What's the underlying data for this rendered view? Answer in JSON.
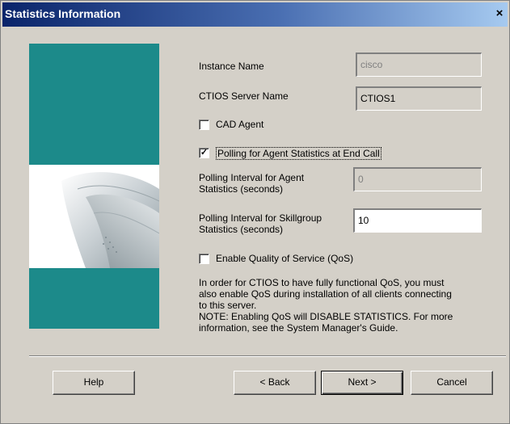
{
  "window": {
    "title": "Statistics Information",
    "close_label": "×"
  },
  "form": {
    "instance_name_label": "Instance Name",
    "instance_name_value": "cisco",
    "ctios_server_label": "CTIOS Server Name",
    "ctios_server_value": "CTIOS1",
    "cad_agent_label": "CAD Agent",
    "cad_agent_checked": false,
    "polling_label": "Polling for Agent Statistics at End Call",
    "polling_checked": true,
    "agent_interval_label_1": "Polling Interval for Agent",
    "agent_interval_label_2": "Statistics (seconds)",
    "agent_interval_value": "0",
    "skill_interval_label_1": "Polling Interval for Skillgroup",
    "skill_interval_label_2": "Statistics (seconds)",
    "skill_interval_value": "10",
    "qos_label": "Enable Quality of Service (QoS)",
    "qos_checked": false
  },
  "info": {
    "line1": "In order for CTIOS to have fully functional QoS, you must",
    "line2": "also enable QoS during installation of all clients connecting",
    "line3": "to this server.",
    "line4": "NOTE: Enabling QoS will DISABLE STATISTICS. For more",
    "line5": "information, see the System Manager's Guide."
  },
  "buttons": {
    "help": "Help",
    "back": "< Back",
    "next": "Next >",
    "cancel": "Cancel"
  },
  "colors": {
    "banner": "#1c8a8a",
    "titlebar": "#0a246a",
    "dialog": "#d4d0c8"
  }
}
